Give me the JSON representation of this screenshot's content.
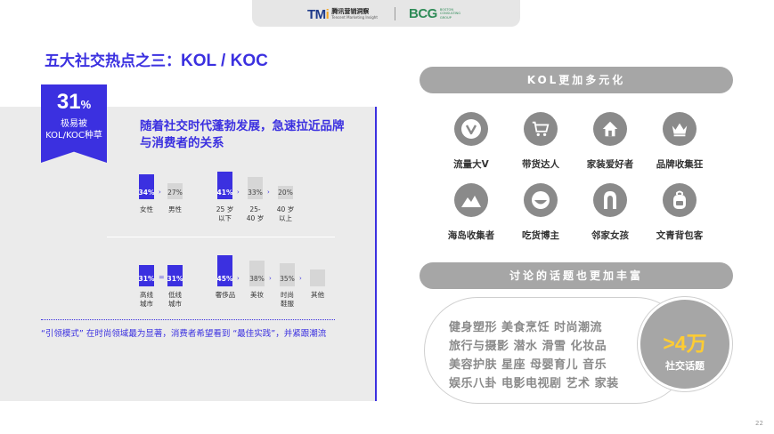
{
  "logos": {
    "tmi_mark_a": "TM",
    "tmi_mark_i": "i",
    "tmi_cn": "腾讯营销洞察",
    "tmi_en": "Tencent Marketing Insight",
    "bcg_mark": "BCG",
    "bcg_line1": "BOSTON",
    "bcg_line2": "CONSULTING",
    "bcg_line3": "GROUP"
  },
  "title": {
    "prefix": "五大社交热点之三：",
    "highlight": "KOL / KOC"
  },
  "ribbon": {
    "pct": "31",
    "pct_unit": "%",
    "line1": "极易被",
    "line2": "KOL/KOC种草"
  },
  "headline": "随着社交时代蓬勃发展，急速拉近品牌与消费者的关系",
  "bars_row1": [
    {
      "value": "34%",
      "label": "女性",
      "level": 34
    },
    {
      "value": "27%",
      "label": "男性",
      "level": 27
    },
    {
      "value": "41%",
      "label": "25 岁以下",
      "level": 41
    },
    {
      "value": "33%",
      "label": "25-40 岁",
      "level": 33
    },
    {
      "value": "20%",
      "label": "40 岁以上",
      "level": 20
    }
  ],
  "bars_row2": [
    {
      "value": "31%",
      "label": "高线城市",
      "level": 31
    },
    {
      "value": "31%",
      "label": "低线城市",
      "level": 31
    },
    {
      "value": "45%",
      "label": "奢侈品",
      "level": 45
    },
    {
      "value": "38%",
      "label": "美妆",
      "level": 38
    },
    {
      "value": "35%",
      "label": "时尚鞋服",
      "level": 35
    },
    {
      "value": "",
      "label": "其他",
      "level": 25
    }
  ],
  "row1_labels": {
    "b0": "女性",
    "b1": "男性",
    "b2a": "25 岁",
    "b2b": "以下",
    "b3a": "25-",
    "b3b": "40 岁",
    "b4a": "40 岁",
    "b4b": "以上"
  },
  "row2_labels": {
    "b0a": "高线",
    "b0b": "城市",
    "b1a": "低线",
    "b1b": "城市",
    "b2": "奢侈品",
    "b3": "美妆",
    "b4a": "时尚",
    "b4b": "鞋服",
    "b5": "其他"
  },
  "equals_sign": "=",
  "footnote": "“引领模式” 在时尚领域最为显著，消费者希望看到 “最佳实践”，并紧跟潮流",
  "right": {
    "pill1": "KOL更加多元化",
    "icons": [
      {
        "name": "v-icon",
        "label": "流量大V"
      },
      {
        "name": "cart-icon",
        "label": "带货达人"
      },
      {
        "name": "house-icon",
        "label": "家装爱好者"
      },
      {
        "name": "crown-icon",
        "label": "品牌收集狂"
      },
      {
        "name": "mountain-icon",
        "label": "海岛收集者"
      },
      {
        "name": "bowl-icon",
        "label": "吃货博主"
      },
      {
        "name": "girl-icon",
        "label": "邻家女孩"
      },
      {
        "name": "backpack-icon",
        "label": "文青背包客"
      }
    ],
    "pill2": "讨论的话题也更加丰富",
    "topics": [
      "健身塑形 美食烹饪 时尚潮流",
      "旅行与摄影  潜水  滑雪  化妆品",
      "美容护肤  星座  母婴育儿  音乐",
      "娱乐八卦 电影电视剧 艺术 家装"
    ],
    "big_number": ">4万",
    "big_label": "社交话题"
  },
  "page_number": "22"
}
